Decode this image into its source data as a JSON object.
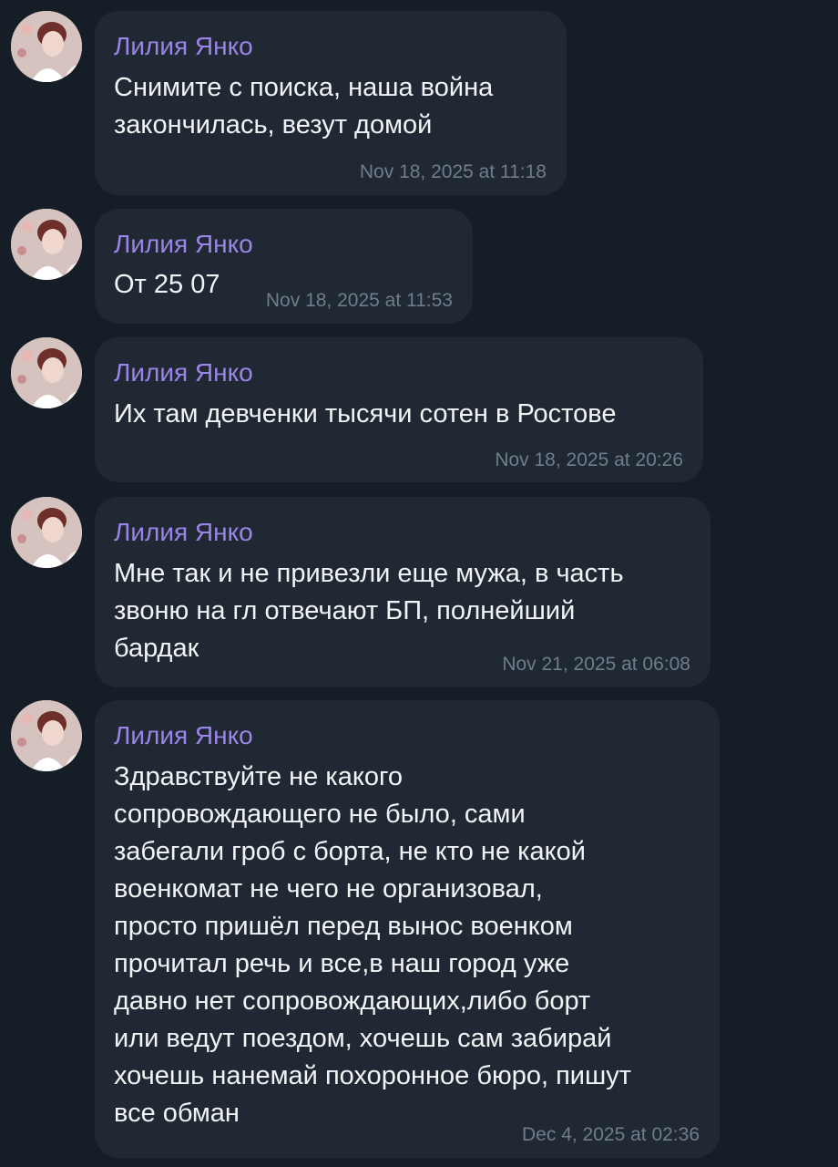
{
  "messages": [
    {
      "sender": "Лилия Янко",
      "text": "Снимите с поиска, наша война\nзакончилась, везут домой",
      "time": "Nov 18, 2025 at 11:18"
    },
    {
      "sender": "Лилия Янко",
      "text": "От 25 07",
      "time": "Nov 18, 2025 at 11:53"
    },
    {
      "sender": "Лилия Янко",
      "text": "Их там девченки тысячи сотен в Ростове",
      "time": "Nov 18, 2025 at 20:26"
    },
    {
      "sender": "Лилия Янко",
      "text": "Мне так и не привезли еще мужа, в часть\nзвоню на гл отвечают БП, полнейший\nбардак",
      "time": "Nov 21, 2025 at 06:08"
    },
    {
      "sender": "Лилия Янко",
      "text": "Здравствуйте не какого\nсопровождающего не было, сами\nзабегали гроб с борта, не кто не какой\nвоенкомат не чего не организовал,\nпросто пришёл перед вынос военком\nпрочитал речь и все,в наш город уже\nдавно нет сопровождающих,либо борт\nили ведут поездом, хочешь сам забирай\nхочешь нанемай похоронное бюро, пишут\nвсе обман",
      "time": "Dec 4, 2025 at 02:36"
    }
  ],
  "colors": {
    "background": "#151d26",
    "bubble": "#1f2833",
    "sender_name": "#9b85e8",
    "message_text": "#f2f4f6",
    "timestamp": "#6f7d8c"
  }
}
